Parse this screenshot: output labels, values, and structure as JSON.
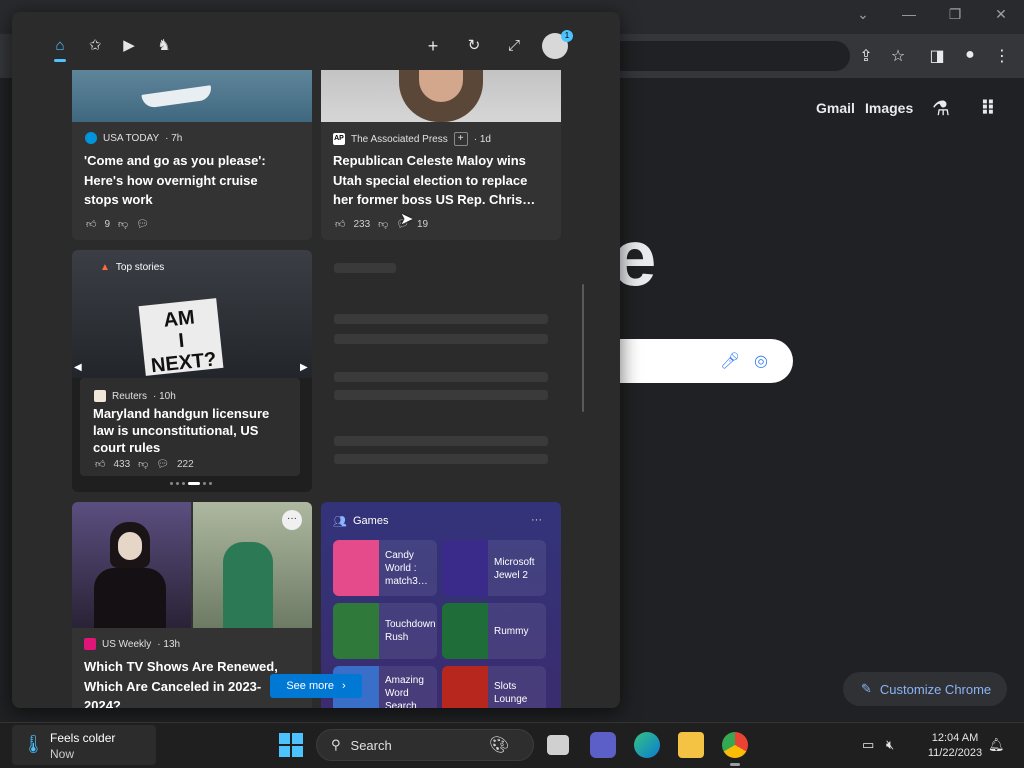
{
  "chrome": {
    "gmail": "Gmail",
    "images": "Images",
    "logo_fragment": "e",
    "customize": "Customize Chrome"
  },
  "widgets": {
    "cards": [
      {
        "source": "USA TODAY",
        "time": "· 7h",
        "headline": "'Come and go as you please': Here's how overnight cruise stops work",
        "likes": "9"
      },
      {
        "source": "The Associated Press",
        "time": "· 1d",
        "headline": "Republican Celeste Maloy wins Utah special election to replace her former boss US Rep. Chris…",
        "likes": "233",
        "comments": "19"
      },
      {
        "tag": "Top stories",
        "source": "Reuters",
        "time": "· 10h",
        "headline": "Maryland handgun licensure law is unconstitutional, US court rules",
        "likes": "433",
        "comments": "222"
      },
      {
        "source": "US Weekly",
        "time": "· 13h",
        "headline": "Which TV Shows Are Renewed, Which Are Canceled in 2023-2024?"
      }
    ],
    "games": {
      "title": "Games",
      "more": "···",
      "items": [
        {
          "name": "Candy World : match3…",
          "color": "#e54b8a"
        },
        {
          "name": "Microsoft Jewel 2",
          "color": "#3a2a8a"
        },
        {
          "name": "Touchdown Rush",
          "color": "#2f7a3a"
        },
        {
          "name": "Rummy",
          "color": "#1f6e3a"
        },
        {
          "name": "Amazing Word Search",
          "color": "#3a6fc9"
        },
        {
          "name": "Slots Lounge",
          "color": "#b8271e"
        }
      ]
    },
    "see_more": "See more"
  },
  "taskbar": {
    "weather_title": "Feels colder",
    "weather_sub": "Now",
    "search": "Search",
    "time": "12:04 AM",
    "date": "11/22/2023"
  }
}
